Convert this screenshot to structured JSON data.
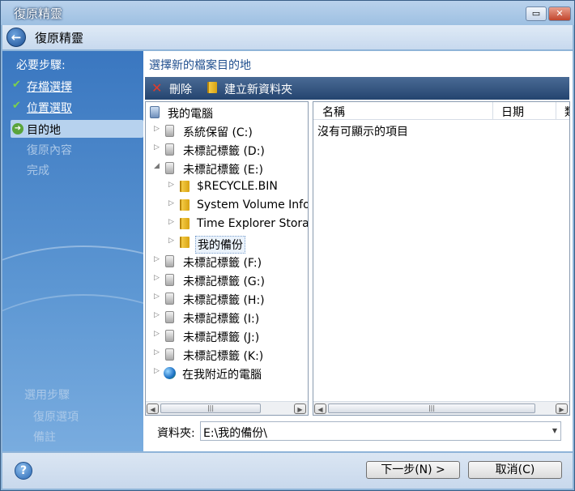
{
  "window": {
    "title": "復原精靈",
    "min_glyph": "▭",
    "close_glyph": "✕"
  },
  "header": {
    "title": "復原精靈",
    "back_glyph": "←"
  },
  "steps": {
    "required_label": "必要步驟:",
    "items": [
      {
        "label": "存檔選擇",
        "state": "done",
        "mark": "✔"
      },
      {
        "label": "位置選取",
        "state": "done",
        "mark": "✔"
      },
      {
        "label": "目的地",
        "state": "current",
        "mark": "➜"
      },
      {
        "label": "復原內容",
        "state": "disabled",
        "mark": ""
      },
      {
        "label": "完成",
        "state": "disabled",
        "mark": ""
      }
    ],
    "optional_label": "選用步驟",
    "optional_items": [
      {
        "label": "復原選項"
      },
      {
        "label": "備註"
      }
    ]
  },
  "main": {
    "heading": "選擇新的檔案目的地",
    "toolbar": {
      "delete_label": "刪除",
      "new_folder_label": "建立新資料夾"
    },
    "tree": [
      {
        "label": "我的電腦",
        "icon": "computer-icon",
        "expander": ""
      },
      {
        "label": "系統保留 (C:)",
        "icon": "drive-icon",
        "expander": "▷"
      },
      {
        "label": "未標記標籤 (D:)",
        "icon": "drive-icon",
        "expander": "▷"
      },
      {
        "label": "未標記標籤 (E:)",
        "icon": "drive-icon",
        "expander": "◢"
      },
      {
        "label": "$RECYCLE.BIN",
        "icon": "folder-icon",
        "expander": "▷"
      },
      {
        "label": "System Volume Information",
        "icon": "folder-icon",
        "expander": "▷"
      },
      {
        "label": "Time Explorer Storage",
        "icon": "folder-icon",
        "expander": "▷"
      },
      {
        "label": "我的備份",
        "icon": "folder-icon",
        "expander": "▷",
        "selected": true
      },
      {
        "label": "未標記標籤 (F:)",
        "icon": "drive-icon",
        "expander": "▷"
      },
      {
        "label": "未標記標籤 (G:)",
        "icon": "drive-icon",
        "expander": "▷"
      },
      {
        "label": "未標記標籤 (H:)",
        "icon": "drive-icon",
        "expander": "▷"
      },
      {
        "label": "未標記標籤 (I:)",
        "icon": "drive-icon",
        "expander": "▷"
      },
      {
        "label": "未標記標籤 (J:)",
        "icon": "drive-icon",
        "expander": "▷"
      },
      {
        "label": "未標記標籤 (K:)",
        "icon": "drive-icon",
        "expander": "▷"
      },
      {
        "label": "在我附近的電腦",
        "icon": "network-icon",
        "expander": "▷"
      }
    ],
    "list": {
      "columns": [
        "名稱",
        "日期",
        "類"
      ],
      "empty_message": "沒有可顯示的項目"
    },
    "folder_label": "資料夾:",
    "folder_value": "E:\\我的備份\\"
  },
  "buttons": {
    "help": "?",
    "next": "下一步(N) >",
    "cancel": "取消(C)"
  }
}
